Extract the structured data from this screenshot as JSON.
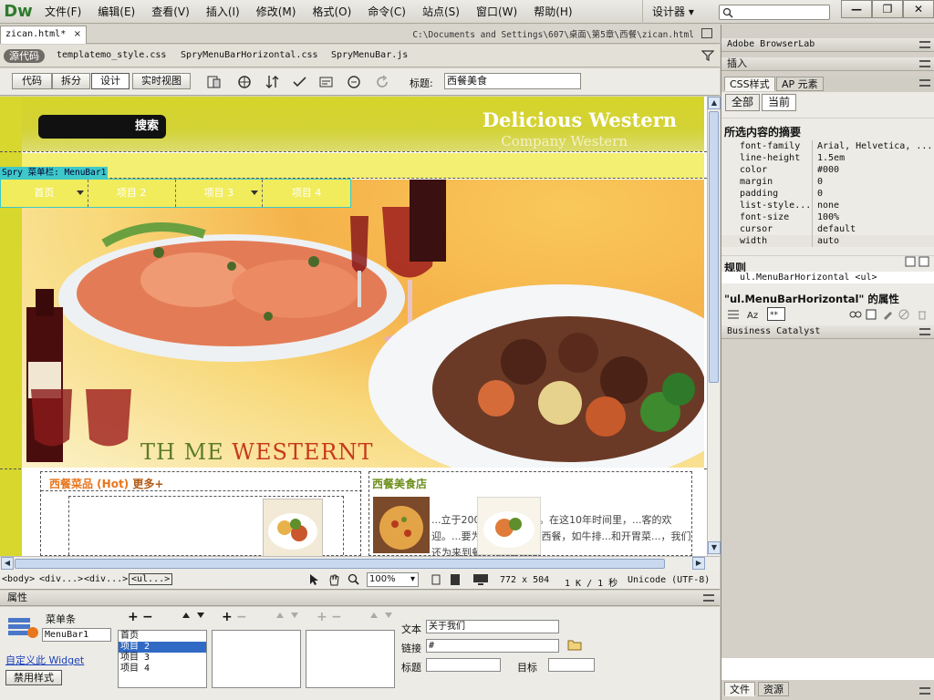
{
  "app": {
    "logo": "Dw",
    "menu": [
      "文件(F)",
      "编辑(E)",
      "查看(V)",
      "插入(I)",
      "修改(M)",
      "格式(O)",
      "命令(C)",
      "站点(S)",
      "窗口(W)",
      "帮助(H)"
    ],
    "workspace": "设计器",
    "window_buttons": [
      "—",
      "❐",
      "✕"
    ]
  },
  "document": {
    "tab_label": "zican.html*",
    "path": "C:\\Documents and Settings\\607\\桌面\\第5章\\西餐\\zican.html",
    "source_label": "源代码",
    "related_files": [
      "templatemo_style.css",
      "SpryMenuBarHorizontal.css",
      "SpryMenuBar.js"
    ]
  },
  "view_toolbar": {
    "buttons": [
      "代码",
      "拆分",
      "设计",
      "实时视图"
    ],
    "active": "设计",
    "title_label": "标题:",
    "title_value": "西餐美食"
  },
  "page": {
    "search_button": "搜索",
    "brand_title": "Delicious Western",
    "brand_subtitle": "Company Western",
    "spry_tag": "Spry 菜单栏: MenuBar1",
    "menu_items": [
      "首页",
      "项目 2",
      "项目 3",
      "项目 4"
    ],
    "tagline_a": "TH ME ",
    "tagline_b": "WESTERNT",
    "hot_title": "西餐菜品 (Hot)",
    "hot_more": "更多+",
    "shop_title": "西餐美食店",
    "shop_text": "...立于2003...10年历史。在这10年时间里，...客的欢迎。...要为大家提供各种西餐，如牛排...和开胃菜...，我们还为来到餐厅用餐的顾..."
  },
  "status": {
    "tags": [
      "<body>",
      "<div...>",
      "<div...>",
      "<ul...>"
    ],
    "selected_tag": "<ul...>",
    "zoom": "100%",
    "dimensions": "772 x 504",
    "filesize": "1 K / 1 秒",
    "encoding": "Unicode (UTF-8)"
  },
  "properties": {
    "header": "属性",
    "type_label": "菜单条",
    "name_value": "MenuBar1",
    "widget_link": "自定义此 Widget",
    "disable_button": "禁用样式",
    "list_items": [
      "首页",
      "项目 2",
      "项目 3",
      "项目 4"
    ],
    "selected_index": 1,
    "text_label": "文本",
    "text_value": "关于我们",
    "link_label": "链接",
    "link_value": "#",
    "title_label": "标题",
    "target_label": "目标"
  },
  "right_panel": {
    "browserlab": "Adobe BrowserLab",
    "insert": "插入",
    "tabs": [
      "CSS样式",
      "AP 元素"
    ],
    "mode_buttons": [
      "全部",
      "当前"
    ],
    "summary_title": "所选内容的摘要",
    "properties": [
      {
        "k": "font-family",
        "v": "Arial, Helvetica, ..."
      },
      {
        "k": "line-height",
        "v": "1.5em"
      },
      {
        "k": "color",
        "v": "#000"
      },
      {
        "k": "margin",
        "v": "0"
      },
      {
        "k": "padding",
        "v": "0"
      },
      {
        "k": "list-style...",
        "v": "none"
      },
      {
        "k": "font-size",
        "v": "100%"
      },
      {
        "k": "cursor",
        "v": "default"
      },
      {
        "k": "width",
        "v": "auto"
      }
    ],
    "rules_title": "规则",
    "rule": "ul.MenuBarHorizontal <ul>",
    "attr_title": "\"ul.MenuBarHorizontal\" 的属性",
    "business_catalyst": "Business Catalyst",
    "bottom_tabs": [
      "文件",
      "资源"
    ]
  },
  "colors": {
    "header_yellow": "#d6d52a",
    "menu_yellow": "#f1ec5b",
    "spry_cyan": "#3ec8c8",
    "hot_orange": "#e8761d",
    "shop_green": "#6d8f1a",
    "selection_blue": "#316ac5"
  }
}
